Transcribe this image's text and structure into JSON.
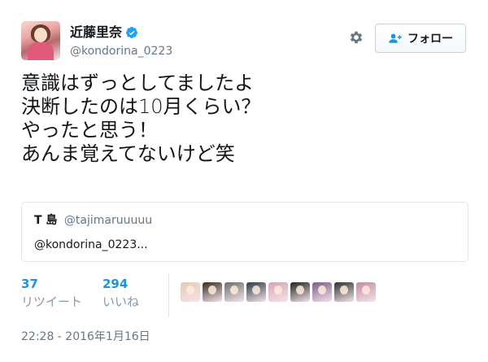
{
  "author": {
    "display_name": "近藤里奈",
    "handle": "@kondorina_0223",
    "verified": true
  },
  "actions": {
    "follow_label": "フォロー"
  },
  "tweet": {
    "lines": [
      "意識はずっとしてましたよ",
      "決断したのは10月くらい？",
      "やったと思う！",
      "あんま覚えてないけど笑"
    ]
  },
  "quote": {
    "name": "T 島",
    "handle": "@tajimaruuuuu",
    "text": "@kondorina_0223..."
  },
  "stats": {
    "retweets_count": "37",
    "retweets_label": "リツイート",
    "likes_count": "294",
    "likes_label": "いいね"
  },
  "liker_avatar_colors": [
    "#e8c9b4",
    "#3a2a22",
    "#6d6d6d",
    "#2b3a4a",
    "#d9a3b5",
    "#1f1f1f",
    "#7b5a8c",
    "#2e2e2e",
    "#c48aa0"
  ],
  "timestamp": "22:28 - 2016年1月16日",
  "colors": {
    "accent": "#1b95e0",
    "verified": "#1da1f2",
    "secondary_text": "#657786"
  }
}
